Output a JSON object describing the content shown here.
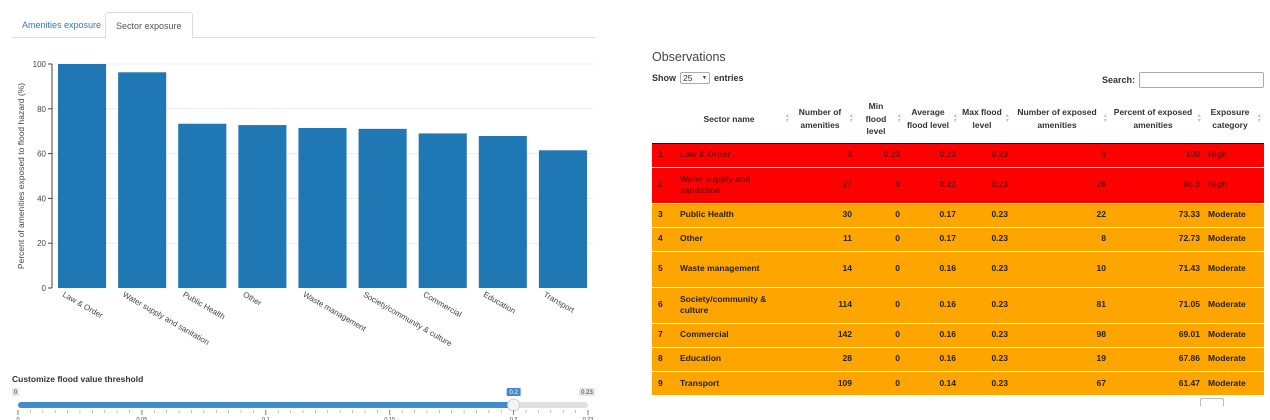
{
  "tabs": [
    {
      "label": "Amenities exposure",
      "active": false
    },
    {
      "label": "Sector exposure",
      "active": true
    }
  ],
  "chart_data": {
    "type": "bar",
    "ylabel": "Percent of amenities exposed to flood hazard (%)",
    "xlabel": "",
    "ylim": [
      0,
      100
    ],
    "yticks": [
      0,
      20,
      40,
      60,
      80,
      100
    ],
    "color": "#1f77b4",
    "grid": true,
    "categories": [
      "Law & Order",
      "Water supply and sanitation",
      "Public Health",
      "Other",
      "Waste management",
      "Society/community & culture",
      "Commercial",
      "Education",
      "Transport"
    ],
    "values": [
      100,
      96.3,
      73.33,
      72.73,
      71.43,
      71.05,
      69.01,
      67.86,
      61.47
    ]
  },
  "slider": {
    "title": "Customize flood value threshold",
    "min": 0,
    "max": 0.23,
    "value": 0.2,
    "min_label": "0",
    "max_label": "0.23",
    "value_label": "0.2",
    "ticks": [
      "0",
      "0.05",
      "0.1",
      "0.15",
      "0.2",
      "0.23"
    ],
    "color": "#428bca"
  },
  "table": {
    "title": "Observations",
    "show_label": "Show",
    "entries_value": "25",
    "entries_label": "entries",
    "search_label": "Search:",
    "search_value": "",
    "headers": [
      "",
      "Sector name",
      "Number of amenities",
      "Min flood level",
      "Average flood level",
      "Max flood level",
      "Number of exposed amenities",
      "Percent of exposed amenities",
      "Exposure category"
    ],
    "colors": {
      "High": "#ff0000",
      "Moderate": "#ffa500"
    },
    "rows": [
      {
        "idx": "1",
        "name": "Law & Order",
        "n": "3",
        "min": "0.23",
        "avg": "0.23",
        "max": "0.23",
        "exposed": "3",
        "pct": "100",
        "cat": "High"
      },
      {
        "idx": "2",
        "name": "Water supply and sanitation",
        "n": "27",
        "min": "0",
        "avg": "0.22",
        "max": "0.23",
        "exposed": "26",
        "pct": "96.3",
        "cat": "High"
      },
      {
        "idx": "3",
        "name": "Public Health",
        "n": "30",
        "min": "0",
        "avg": "0.17",
        "max": "0.23",
        "exposed": "22",
        "pct": "73.33",
        "cat": "Moderate"
      },
      {
        "idx": "4",
        "name": "Other",
        "n": "11",
        "min": "0",
        "avg": "0.17",
        "max": "0.23",
        "exposed": "8",
        "pct": "72.73",
        "cat": "Moderate"
      },
      {
        "idx": "5",
        "name": "Waste management",
        "n": "14",
        "min": "0",
        "avg": "0.16",
        "max": "0.23",
        "exposed": "10",
        "pct": "71.43",
        "cat": "Moderate"
      },
      {
        "idx": "6",
        "name": "Society/community & culture",
        "n": "114",
        "min": "0",
        "avg": "0.16",
        "max": "0.23",
        "exposed": "81",
        "pct": "71.05",
        "cat": "Moderate"
      },
      {
        "idx": "7",
        "name": "Commercial",
        "n": "142",
        "min": "0",
        "avg": "0.16",
        "max": "0.23",
        "exposed": "98",
        "pct": "69.01",
        "cat": "Moderate"
      },
      {
        "idx": "8",
        "name": "Education",
        "n": "28",
        "min": "0",
        "avg": "0.16",
        "max": "0.23",
        "exposed": "19",
        "pct": "67.86",
        "cat": "Moderate"
      },
      {
        "idx": "9",
        "name": "Transport",
        "n": "109",
        "min": "0",
        "avg": "0.14",
        "max": "0.23",
        "exposed": "67",
        "pct": "61.47",
        "cat": "Moderate"
      }
    ]
  }
}
